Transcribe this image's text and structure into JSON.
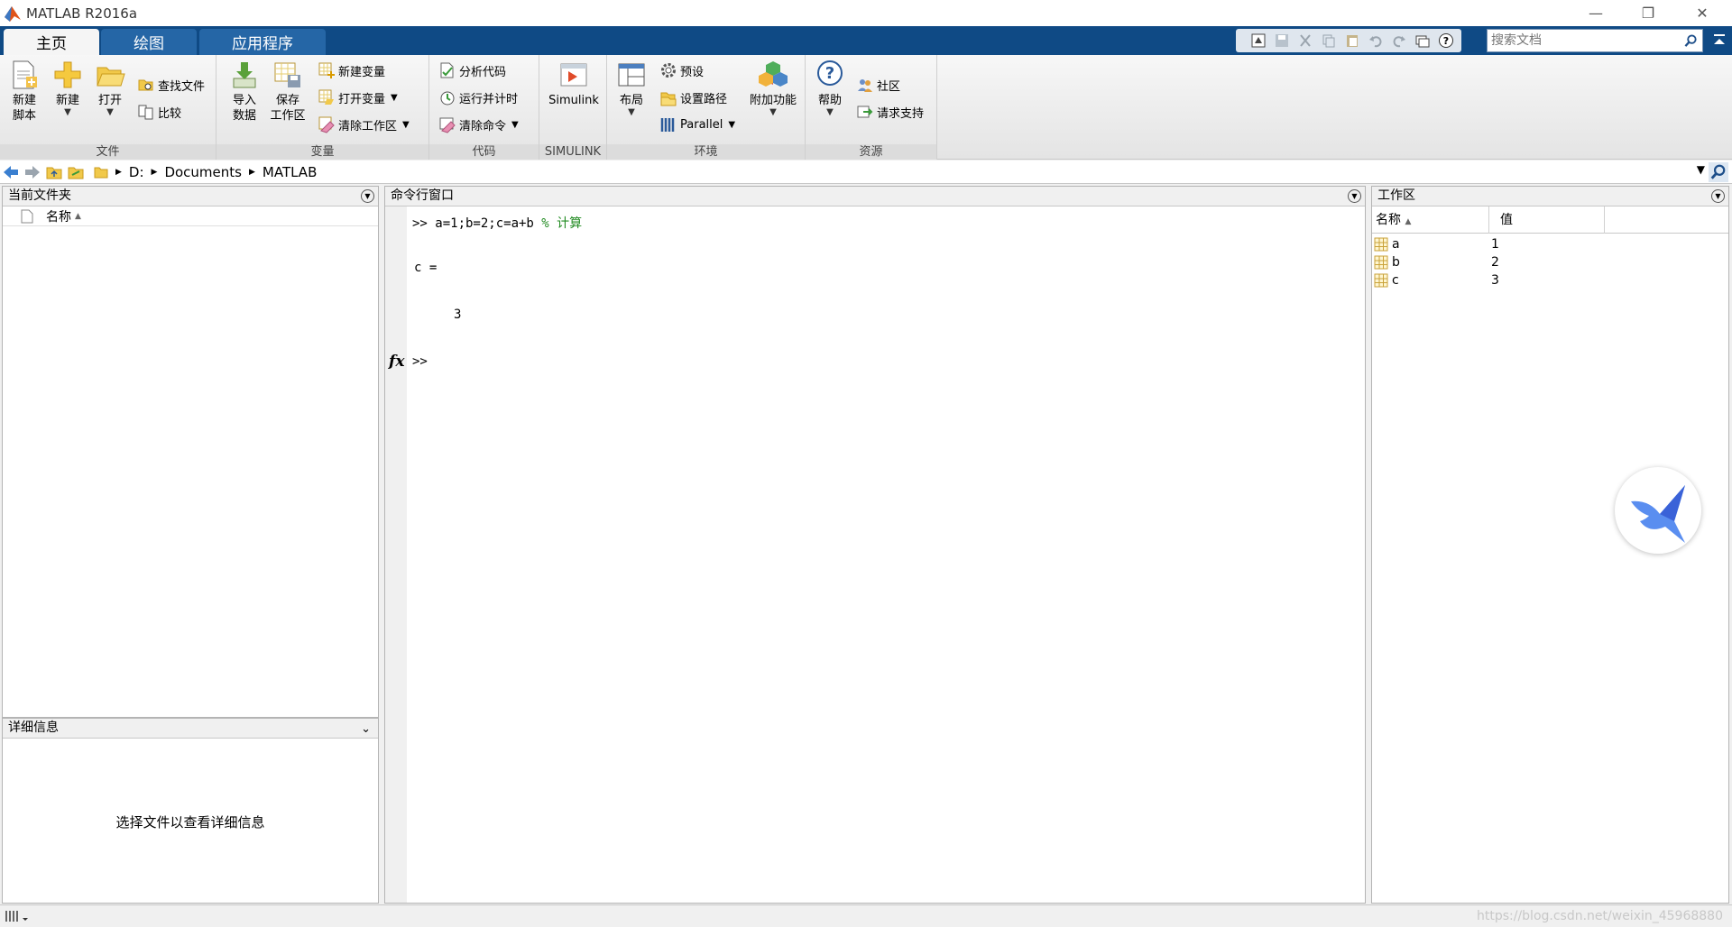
{
  "window": {
    "title": "MATLAB R2016a"
  },
  "tabs": [
    {
      "label": "主页",
      "active": true
    },
    {
      "label": "绘图",
      "active": false
    },
    {
      "label": "应用程序",
      "active": false
    }
  ],
  "search": {
    "placeholder": "搜索文档"
  },
  "ribbon": {
    "file": {
      "label": "文件",
      "new_script": "新建\n脚本",
      "new": "新建",
      "open": "打开",
      "find_files": "查找文件",
      "compare": "比较"
    },
    "variable": {
      "label": "变量",
      "import": "导入\n数据",
      "save_ws": "保存\n工作区",
      "new_var": "新建变量",
      "open_var": "打开变量",
      "clear_ws": "清除工作区"
    },
    "code": {
      "label": "代码",
      "analyze": "分析代码",
      "run_time": "运行并计时",
      "clear_cmd": "清除命令"
    },
    "simulink": {
      "label": "SIMULINK",
      "simulink": "Simulink"
    },
    "env": {
      "label": "环境",
      "layout": "布局",
      "prefs": "预设",
      "set_path": "设置路径",
      "parallel": "Parallel",
      "addons": "附加功能"
    },
    "resources": {
      "label": "资源",
      "help": "帮助",
      "community": "社区",
      "support": "请求支持"
    }
  },
  "address": {
    "crumbs": [
      "D:",
      "Documents",
      "MATLAB"
    ]
  },
  "current_folder": {
    "title": "当前文件夹",
    "col_name": "名称"
  },
  "details": {
    "title": "详细信息",
    "message": "选择文件以查看详细信息"
  },
  "command_window": {
    "title": "命令行窗口",
    "prompt": ">>",
    "input": " a=1;b=2;c=a+b ",
    "comment": "% 计算",
    "output_var": "c =",
    "output_val": "3",
    "fx": "fx"
  },
  "workspace": {
    "title": "工作区",
    "col_name": "名称",
    "col_value": "值",
    "rows": [
      {
        "name": "a",
        "value": "1"
      },
      {
        "name": "b",
        "value": "2"
      },
      {
        "name": "c",
        "value": "3"
      }
    ]
  },
  "status": {
    "watermark": "https://blog.csdn.net/weixin_45968880"
  },
  "colors": {
    "tab_bar": "#0f4a85",
    "comment": "#228b22"
  }
}
